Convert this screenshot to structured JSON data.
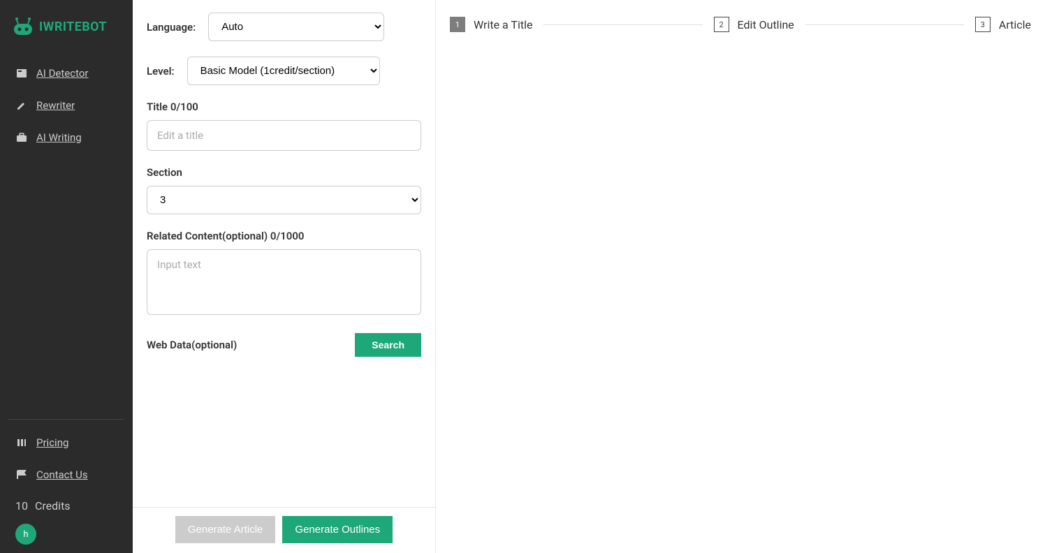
{
  "brand": {
    "name": "IWRITEBOT"
  },
  "sidebar": {
    "nav": [
      {
        "label": "AI Detector"
      },
      {
        "label": "Rewriter"
      },
      {
        "label": "AI Writing"
      }
    ],
    "bottomNav": [
      {
        "label": "Pricing"
      },
      {
        "label": "Contact Us"
      }
    ],
    "credits": {
      "count": "10",
      "label": "Credits"
    },
    "avatar": "h"
  },
  "form": {
    "language": {
      "label": "Language:",
      "value": "Auto"
    },
    "level": {
      "label": "Level:",
      "value": "Basic Model (1credit/section)"
    },
    "title": {
      "label": "Title 0/100",
      "placeholder": "Edit a title"
    },
    "section": {
      "label": "Section",
      "value": "3"
    },
    "related": {
      "label": "Related Content(optional) 0/1000",
      "placeholder": "Input text"
    },
    "webdata": {
      "label": "Web Data(optional)",
      "searchBtn": "Search"
    },
    "footer": {
      "generateArticle": "Generate Article",
      "generateOutlines": "Generate Outlines"
    }
  },
  "stepper": {
    "steps": [
      {
        "num": "1",
        "label": "Write a Title"
      },
      {
        "num": "2",
        "label": "Edit Outline"
      },
      {
        "num": "3",
        "label": "Article"
      }
    ]
  }
}
